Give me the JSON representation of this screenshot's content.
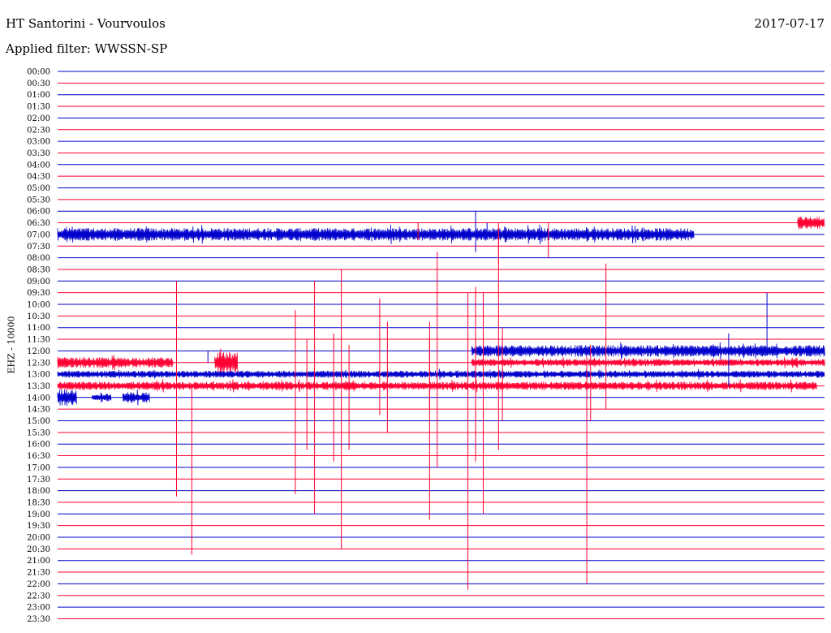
{
  "header": {
    "station": "HT Santorini - Vourvoulos",
    "date": "2017-07-17",
    "filter": "Applied filter: WWSSN-SP"
  },
  "chart_data": {
    "type": "line",
    "chart_kind": "helicorder",
    "ylabel": "EHZ - 10000",
    "row_labels": [
      "00:00",
      "00:30",
      "01:00",
      "01:30",
      "02:00",
      "02:30",
      "03:00",
      "03:30",
      "04:00",
      "04:30",
      "05:00",
      "05:30",
      "06:00",
      "06:30",
      "07:00",
      "07:30",
      "08:00",
      "08:30",
      "09:00",
      "09:30",
      "10:00",
      "10:30",
      "11:00",
      "11:30",
      "12:00",
      "12:30",
      "13:00",
      "13:30",
      "14:00",
      "14:30",
      "15:00",
      "15:30",
      "16:00",
      "16:30",
      "17:00",
      "17:30",
      "18:00",
      "18:30",
      "19:00",
      "19:30",
      "20:00",
      "20:30",
      "21:00",
      "21:30",
      "22:00",
      "22:30",
      "23:00",
      "23:30"
    ],
    "row_colors": [
      "#0000cc",
      "#ff0033"
    ],
    "grid": true,
    "traces": [
      {
        "row": "06:30",
        "color": "#ff0033",
        "segments": [
          [
            0.965,
            1.0,
            0.55
          ]
        ]
      },
      {
        "row": "07:00",
        "color": "#0000cc",
        "segments": [
          [
            0.0,
            0.83,
            0.55
          ]
        ]
      },
      {
        "row": "12:00",
        "color": "#0000cc",
        "segments": [
          [
            0.54,
            1.0,
            0.5
          ]
        ]
      },
      {
        "row": "12:30",
        "color": "#ff0033",
        "segments": [
          [
            0.0,
            0.15,
            0.45
          ],
          [
            0.205,
            0.235,
            0.9
          ],
          [
            0.54,
            1.0,
            0.3
          ]
        ]
      },
      {
        "row": "13:00",
        "color": "#0000cc",
        "segments": [
          [
            0.0,
            1.0,
            0.3
          ]
        ]
      },
      {
        "row": "13:30",
        "color": "#ff0033",
        "segments": [
          [
            0.0,
            0.99,
            0.35
          ]
        ]
      },
      {
        "row": "14:00",
        "color": "#0000cc",
        "segments": [
          [
            0.0,
            0.025,
            0.7
          ],
          [
            0.045,
            0.07,
            0.35
          ],
          [
            0.085,
            0.12,
            0.45
          ]
        ]
      }
    ],
    "events": [
      {
        "row": "13:30",
        "x": 0.155,
        "up": 9.0,
        "down": 9.5,
        "color": "#ff0033"
      },
      {
        "row": "13:30",
        "x": 0.175,
        "up": 0,
        "down": 14.5,
        "color": "#ff0033"
      },
      {
        "row": "13:30",
        "x": 0.31,
        "up": 6.5,
        "down": 9.3,
        "color": "#ff0033"
      },
      {
        "row": "13:30",
        "x": 0.325,
        "up": 4.0,
        "down": 5.5,
        "color": "#ff0033"
      },
      {
        "row": "13:30",
        "x": 0.335,
        "up": 9.0,
        "down": 11.0,
        "color": "#ff0033"
      },
      {
        "row": "13:30",
        "x": 0.36,
        "up": 4.5,
        "down": 6.5,
        "color": "#ff0033"
      },
      {
        "row": "13:30",
        "x": 0.37,
        "up": 10.0,
        "down": 14.0,
        "color": "#ff0033"
      },
      {
        "row": "13:30",
        "x": 0.38,
        "up": 3.5,
        "down": 5.5,
        "color": "#ff0033"
      },
      {
        "row": "13:30",
        "x": 0.42,
        "up": 7.5,
        "down": 2.5,
        "color": "#ff0033"
      },
      {
        "row": "13:30",
        "x": 0.43,
        "up": 5.5,
        "down": 4.0,
        "color": "#ff0033"
      },
      {
        "row": "13:30",
        "x": 0.485,
        "up": 4.0,
        "down": 2.0,
        "color": "#ff0033"
      },
      {
        "row": "13:30",
        "x": 0.485,
        "up": 5.5,
        "down": 11.5,
        "color": "#ff0033"
      },
      {
        "row": "13:30",
        "x": 0.495,
        "up": 11.5,
        "down": 7.0,
        "color": "#ff0033"
      },
      {
        "row": "13:30",
        "x": 0.535,
        "up": 8.0,
        "down": 17.5,
        "color": "#ff0033"
      },
      {
        "row": "13:30",
        "x": 0.545,
        "up": 8.5,
        "down": 6.5,
        "color": "#ff0033"
      },
      {
        "row": "13:30",
        "x": 0.555,
        "up": 8.0,
        "down": 11.0,
        "color": "#ff0033"
      },
      {
        "row": "13:30",
        "x": 0.575,
        "up": 13.5,
        "down": 5.5,
        "color": "#ff0033"
      },
      {
        "row": "13:30",
        "x": 0.58,
        "up": 5.0,
        "down": 3.0,
        "color": "#ff0033"
      },
      {
        "row": "13:30",
        "x": 0.69,
        "up": 2.5,
        "down": 17.0,
        "color": "#ff0033"
      },
      {
        "row": "13:30",
        "x": 0.695,
        "up": 3.5,
        "down": 3.0,
        "color": "#ff0033"
      },
      {
        "row": "13:30",
        "x": 0.715,
        "up": 10.5,
        "down": 2.0,
        "color": "#ff0033"
      },
      {
        "row": "12:00",
        "x": 0.875,
        "up": 1.5,
        "down": 3.0,
        "color": "#0000cc"
      },
      {
        "row": "12:00",
        "x": 0.925,
        "up": 5.0,
        "down": 0,
        "color": "#0000cc"
      },
      {
        "row": "12:00",
        "x": 0.196,
        "up": 0,
        "down": 1.0,
        "color": "#0000cc"
      },
      {
        "row": "06:30",
        "x": 0.545,
        "up": 1.0,
        "down": 2.5,
        "color": "#0000cc"
      },
      {
        "row": "06:30",
        "x": 0.575,
        "up": 0,
        "down": 3.5,
        "color": "#ff0033"
      },
      {
        "row": "06:30",
        "x": 0.64,
        "up": 0,
        "down": 3.0,
        "color": "#ff0033"
      },
      {
        "row": "06:30",
        "x": 0.47,
        "up": 0,
        "down": 1.5,
        "color": "#ff0033"
      },
      {
        "row": "06:30",
        "x": 0.56,
        "up": 0,
        "down": 1.0,
        "color": "#0000cc"
      }
    ]
  }
}
